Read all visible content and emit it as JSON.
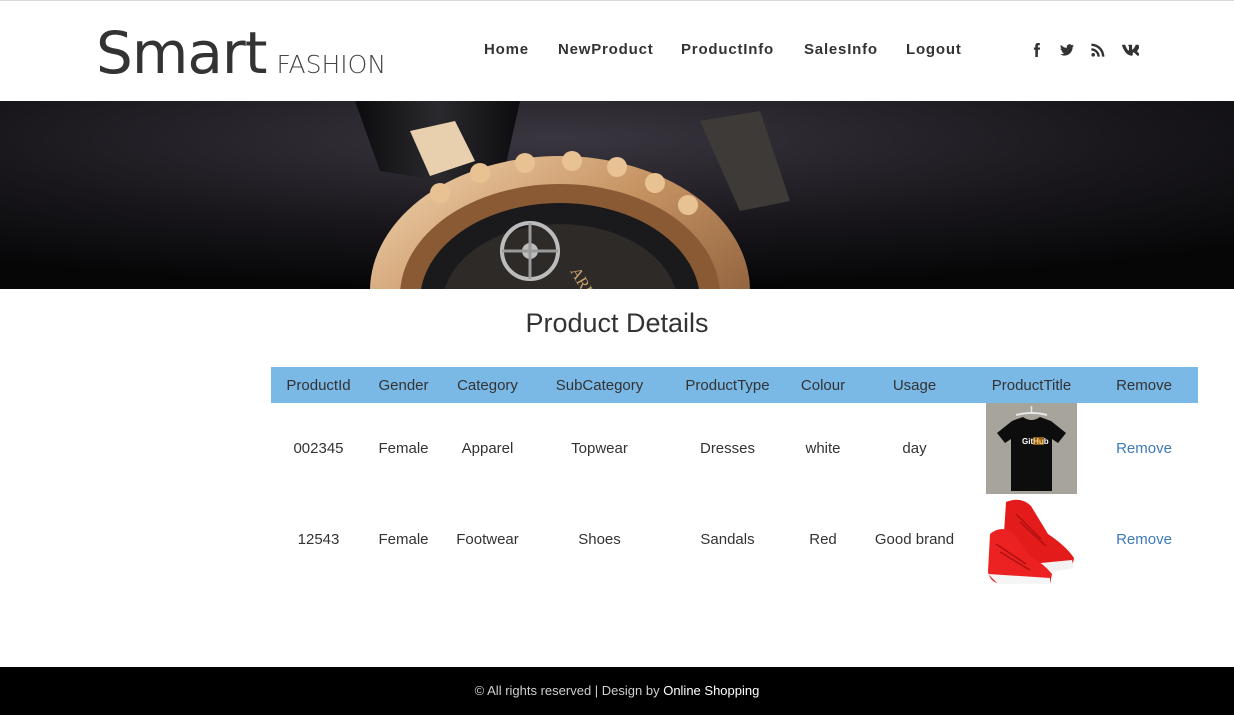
{
  "brand": {
    "main": "Smart",
    "sub": "FASHION"
  },
  "nav": {
    "items": [
      {
        "label": "Home"
      },
      {
        "label": "NewProduct"
      },
      {
        "label": "ProductInfo"
      },
      {
        "label": "SalesInfo"
      },
      {
        "label": "Logout"
      }
    ]
  },
  "social": [
    "facebook-icon",
    "twitter-icon",
    "rss-icon",
    "vk-icon"
  ],
  "page_title": "Product Details",
  "table": {
    "headers": [
      "ProductId",
      "Gender",
      "Category",
      "SubCategory",
      "ProductType",
      "Colour",
      "Usage",
      "ProductTitle",
      "Remove"
    ],
    "rows": [
      {
        "id": "002345",
        "gender": "Female",
        "category": "Apparel",
        "subcategory": "Topwear",
        "type": "Dresses",
        "colour": "white",
        "usage": "day",
        "image": "black-tshirt-image",
        "image_text": "GitHub",
        "remove": "Remove"
      },
      {
        "id": "12543",
        "gender": "Female",
        "category": "Footwear",
        "subcategory": "Shoes",
        "type": "Sandals",
        "colour": "Red",
        "usage": "Good brand",
        "image": "red-shoes-image",
        "remove": "Remove"
      }
    ]
  },
  "footer": {
    "text": "© All rights reserved | Design by ",
    "brand": "Online Shopping"
  },
  "colors": {
    "header_row": "#7ab8e6",
    "link": "#3d7ab8",
    "footer_bg": "#000000"
  }
}
